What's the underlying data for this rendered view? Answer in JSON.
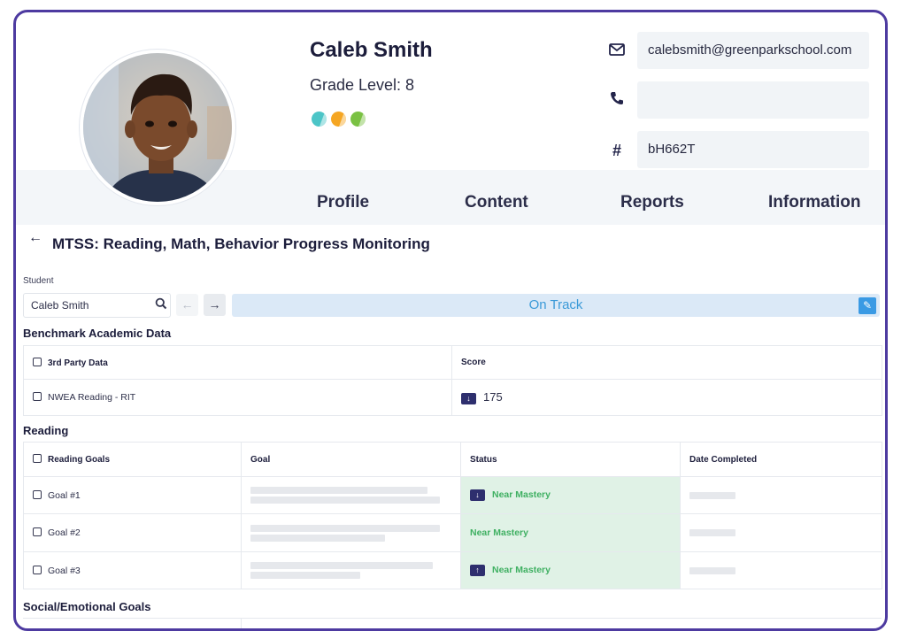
{
  "student": {
    "name": "Caleb Smith",
    "grade_label": "Grade Level: 8",
    "status_dots": [
      {
        "icon": "teal-half-dot",
        "color": "#4cc5c7"
      },
      {
        "icon": "orange-half-dot",
        "color": "#f5a623"
      },
      {
        "icon": "green-half-dot",
        "color": "#7ac143"
      }
    ]
  },
  "contact": {
    "email": "calebsmith@greenparkschool.com",
    "phone": "",
    "id_code": "bH662T"
  },
  "tabs": [
    "Profile",
    "Content",
    "Reports",
    "Information"
  ],
  "page": {
    "title": "MTSS: Reading, Math, Behavior Progress Monitoring",
    "student_label": "Student",
    "student_value": "Caleb Smith",
    "status_text": "On Track"
  },
  "benchmark": {
    "section_title": "Benchmark Academic Data",
    "headers": [
      "3rd Party Data",
      "Score"
    ],
    "rows": [
      {
        "name": "NWEA Reading - RIT",
        "trend": "down",
        "score": "175"
      }
    ]
  },
  "reading": {
    "section_title": "Reading",
    "headers": [
      "Reading Goals",
      "Goal",
      "Status",
      "Date Completed"
    ],
    "rows": [
      {
        "name": "Goal #1",
        "trend": "down",
        "status": "Near Mastery"
      },
      {
        "name": "Goal #2",
        "trend": "",
        "status": "Near Mastery"
      },
      {
        "name": "Goal #3",
        "trend": "up",
        "status": "Near Mastery"
      }
    ]
  },
  "social": {
    "section_title": "Social/Emotional Goals"
  },
  "colors": {
    "frame_border": "#4d3aa0",
    "on_track": "#3b9ad8",
    "near_mastery": "#3fb062"
  }
}
